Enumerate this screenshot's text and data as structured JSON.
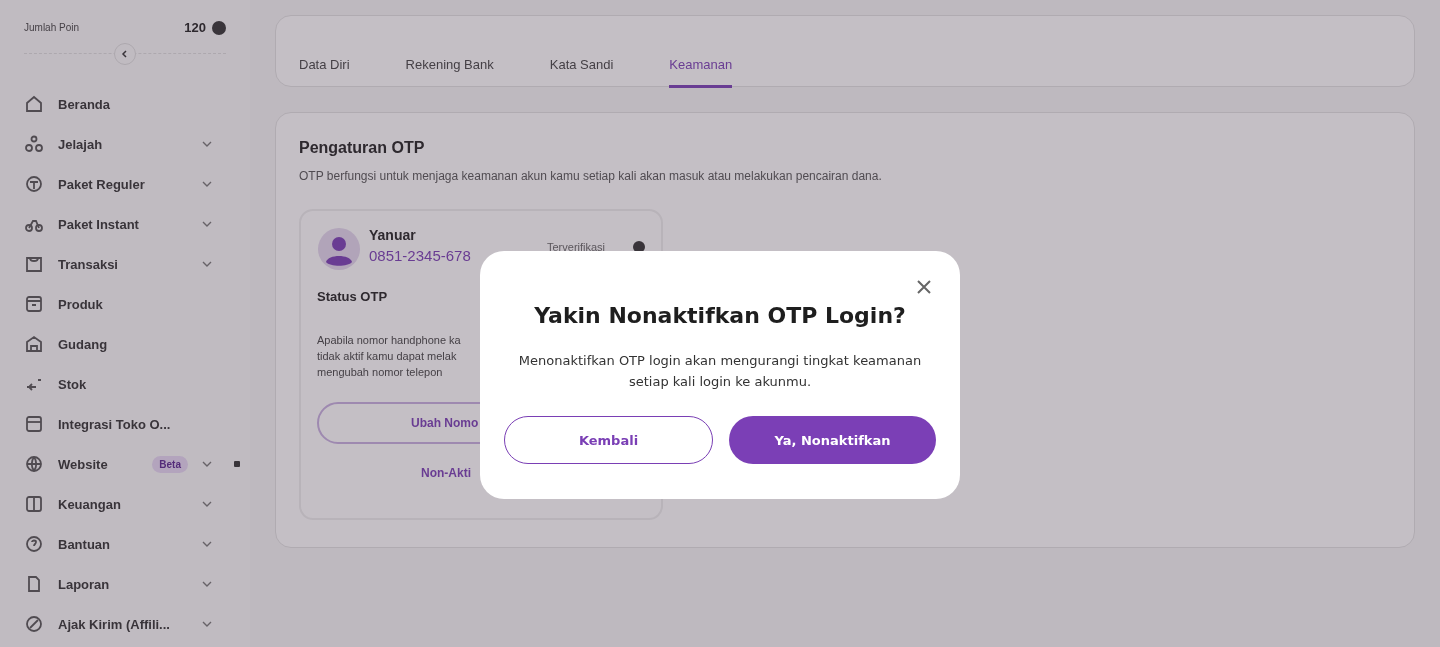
{
  "sidebar": {
    "points_label": "Jumlah Poin",
    "points_value": "120",
    "items": [
      {
        "label": "Beranda",
        "expandable": false
      },
      {
        "label": "Jelajah",
        "expandable": true
      },
      {
        "label": "Paket Reguler",
        "expandable": true
      },
      {
        "label": "Paket Instant",
        "expandable": true
      },
      {
        "label": "Transaksi",
        "expandable": true
      },
      {
        "label": "Produk",
        "expandable": false
      },
      {
        "label": "Gudang",
        "expandable": false
      },
      {
        "label": "Stok",
        "expandable": false
      },
      {
        "label": "Integrasi Toko O...",
        "expandable": false
      },
      {
        "label": "Website",
        "expandable": true,
        "badge": "Beta",
        "dot": true
      },
      {
        "label": "Keuangan",
        "expandable": true
      },
      {
        "label": "Bantuan",
        "expandable": true
      },
      {
        "label": "Laporan",
        "expandable": true
      },
      {
        "label": "Ajak Kirim (Affili...",
        "expandable": true
      }
    ]
  },
  "tabs": [
    {
      "label": "Data Diri",
      "selected": false
    },
    {
      "label": "Rekening Bank",
      "selected": false
    },
    {
      "label": "Kata Sandi",
      "selected": false
    },
    {
      "label": "Keamanan",
      "selected": true
    }
  ],
  "otp": {
    "title": "Pengaturan OTP",
    "description": "OTP berfungsi untuk menjaga keamanan akun kamu setiap kali akan masuk atau melakukan pencairan dana.",
    "user_name": "Yanuar",
    "phone": "0851-2345-678",
    "verified_label": "Terverifikasi",
    "status_title": "Status OTP",
    "note_lines": [
      "Apabila nomor handphone ka",
      "tidak aktif kamu dapat melak",
      "mengubah nomor telepon"
    ],
    "change_button": "Ubah Nomo",
    "deactivate_link": "Non-Akti"
  },
  "dialog": {
    "title": "Yakin Nonaktifkan OTP Login?",
    "message": "Menonaktifkan OTP login akan mengurangi tingkat keamanan setiap kali login ke akunmu.",
    "cancel": "Kembali",
    "confirm": "Ya, Nonaktifkan"
  }
}
